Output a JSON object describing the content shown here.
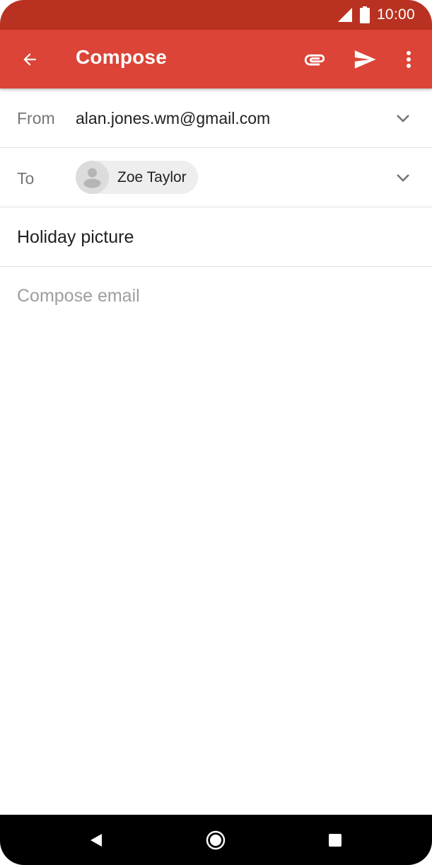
{
  "status_bar": {
    "time": "10:00",
    "icons": [
      "signal-icon",
      "battery-icon"
    ]
  },
  "app_bar": {
    "title": "Compose",
    "actions": [
      "back-arrow-icon",
      "attach-icon",
      "send-icon",
      "more-vert-icon"
    ]
  },
  "compose": {
    "from_label": "From",
    "from_value": "alan.jones.wm@gmail.com",
    "to_label": "To",
    "to_recipients": [
      {
        "name": "Zoe Taylor",
        "icon": "person-icon"
      }
    ],
    "subject": "Holiday picture",
    "body_placeholder": "Compose email",
    "body_value": ""
  },
  "nav_bar": {
    "buttons": [
      "back-triangle-icon",
      "home-circle-icon",
      "recents-square-icon"
    ]
  },
  "colors": {
    "status_bar": "#b93221",
    "app_bar": "#db4437",
    "text_primary": "#212121",
    "text_secondary": "#757575",
    "placeholder": "#9e9e9e",
    "divider": "#e2e2e2",
    "chip_background": "#eeeeee"
  }
}
